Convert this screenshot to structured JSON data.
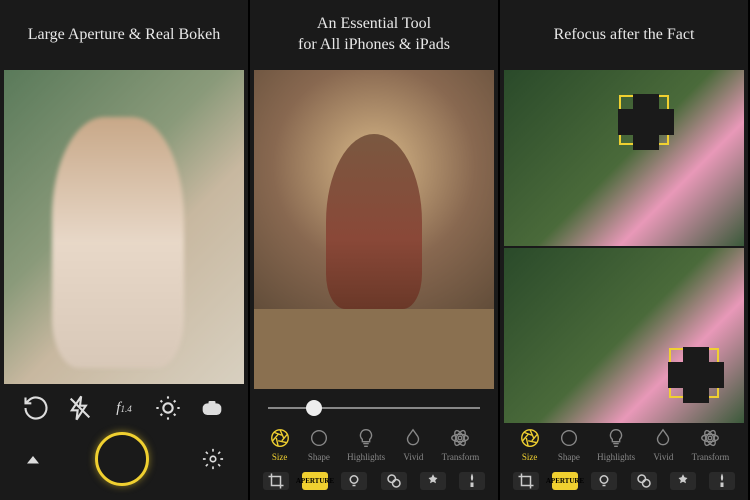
{
  "panels": [
    {
      "heading": "Large Aperture & Real Bokeh"
    },
    {
      "heading": "An Essential Tool\nfor All iPhones & iPads"
    },
    {
      "heading": "Refocus after the Fact"
    }
  ],
  "camera_controls": {
    "aperture_label": "f",
    "aperture_value": "1.4"
  },
  "slider": {
    "position_pct": 18
  },
  "modes": [
    {
      "key": "size",
      "label": "Size",
      "active": true
    },
    {
      "key": "shape",
      "label": "Shape",
      "active": false
    },
    {
      "key": "highlights",
      "label": "Highlights",
      "active": false
    },
    {
      "key": "vivid",
      "label": "Vivid",
      "active": false
    },
    {
      "key": "transform",
      "label": "Transform",
      "active": false
    }
  ],
  "toolstrip": {
    "aperture_label": "APERTURE"
  }
}
